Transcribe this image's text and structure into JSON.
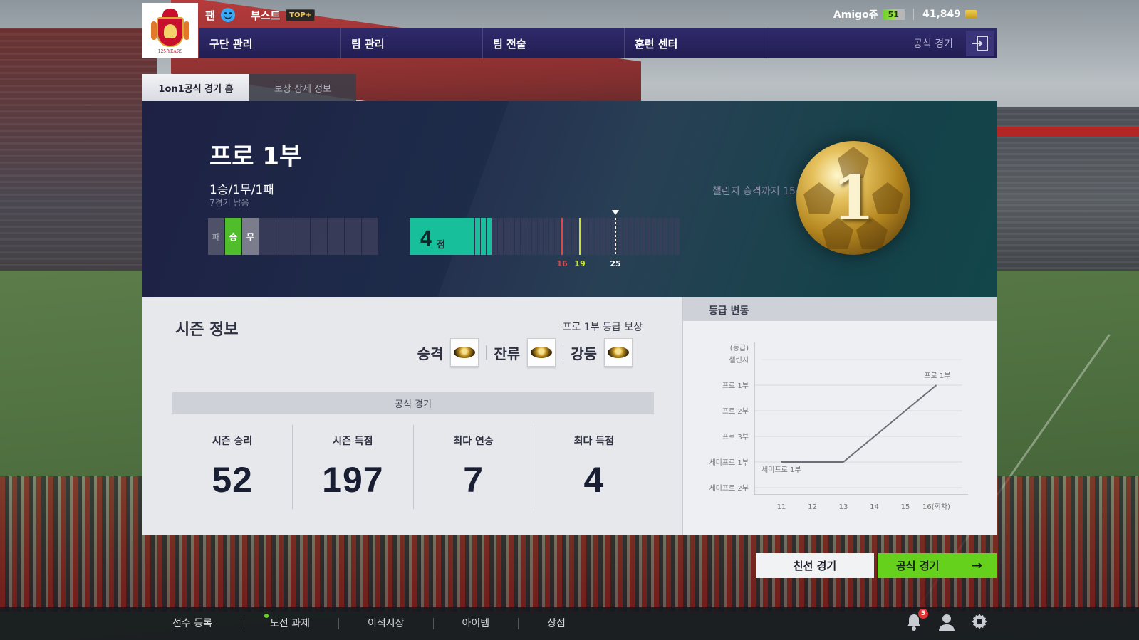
{
  "header": {
    "fan_label": "팬",
    "boost_label": "부스트",
    "boost_badge": "TOP+",
    "currency_name": "Amigo쥬",
    "level": "51",
    "coins": "41,849",
    "crest_text": "125 YEARS"
  },
  "nav": {
    "items": [
      "구단 관리",
      "팀 관리",
      "팀 전술",
      "훈련 센터"
    ],
    "current": "공식 경기"
  },
  "tabs": [
    {
      "label": "1on1공식 경기 홈",
      "active": true
    },
    {
      "label": "보상 상세 정보",
      "active": false
    }
  ],
  "hero": {
    "division": "프로 1부",
    "record": "1승/1무/1패",
    "remaining_games": "7경기 남음",
    "promotion_text": "챌린지 승격까지 15점 남음",
    "results": [
      "패",
      "승",
      "무",
      "",
      "",
      "",
      "",
      "",
      "",
      ""
    ],
    "points": "4",
    "points_unit": "점",
    "markers": [
      {
        "label": "16",
        "value": 16,
        "color": "#e04848"
      },
      {
        "label": "19",
        "value": 19,
        "color": "#c9e03a"
      },
      {
        "label": "25",
        "value": 25,
        "color": "#ffffff"
      }
    ],
    "badge_number": "1"
  },
  "season": {
    "title": "시즌 정보",
    "reward_title": "프로 1부 등급 보상",
    "rewards": [
      "승격",
      "잔류",
      "강등"
    ],
    "section_label": "공식 경기",
    "stats": [
      {
        "label": "시즌 승리",
        "value": "52"
      },
      {
        "label": "시즌 득점",
        "value": "197"
      },
      {
        "label": "최다 연승",
        "value": "7"
      },
      {
        "label": "최다 득점",
        "value": "4"
      }
    ]
  },
  "grade": {
    "title": "등급 변동",
    "chart_data": {
      "type": "line",
      "ylabel": "(등급)",
      "y_categories": [
        "챌린지",
        "프로 1부",
        "프로 2부",
        "프로 3부",
        "세미프로 1부",
        "세미프로 2부"
      ],
      "x": [
        11,
        12,
        13,
        14,
        15,
        16
      ],
      "x_tick_labels": [
        "11",
        "12",
        "13",
        "14",
        "15",
        "16(회차)"
      ],
      "series": [
        {
          "values": [
            "세미프로 1부",
            "세미프로 1부",
            "세미프로 1부",
            null,
            null,
            "프로 1부"
          ]
        }
      ],
      "annotations": [
        {
          "x": 11,
          "text": "세미프로 1부"
        },
        {
          "x": 16,
          "text": "프로 1부"
        }
      ]
    }
  },
  "actions": {
    "friendly": "친선 경기",
    "official": "공식 경기",
    "official_arrow": "→"
  },
  "bottom": {
    "items": [
      "선수 등록",
      "도전 과제",
      "이적시장",
      "아이템",
      "상점"
    ],
    "notifications": "5"
  }
}
